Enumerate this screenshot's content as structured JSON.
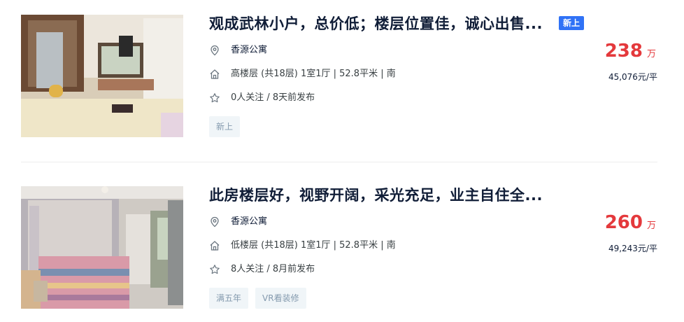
{
  "listings": [
    {
      "title": "观成武林小户，总价低；楼层位置佳，诚心出售...",
      "badge": "新上",
      "community": "香源公寓",
      "house_info": "高楼层 (共18层) 1室1厅 | 52.8平米 | 南",
      "follow_info": "0人关注 / 8天前发布",
      "tags": [
        "新上"
      ],
      "price": "238",
      "price_unit": "万",
      "unit_price": "45,076元/平"
    },
    {
      "title": "此房楼层好，视野开阔，采光充足，业主自住全...",
      "community": "香源公寓",
      "house_info": "低楼层 (共18层) 1室1厅 | 52.8平米 | 南",
      "follow_info": "8人关注 / 8月前发布",
      "tags": [
        "满五年",
        "VR看装修"
      ],
      "price": "260",
      "price_unit": "万",
      "unit_price": "49,243元/平"
    }
  ],
  "icons": {
    "location": "location-pin-icon",
    "house": "house-icon",
    "follow": "star-icon"
  },
  "colors": {
    "price": "#e4393c",
    "badge_bg": "#3072f6",
    "tag_bg": "#f0f5f8",
    "tag_text": "#849aae",
    "title": "#101d37"
  }
}
